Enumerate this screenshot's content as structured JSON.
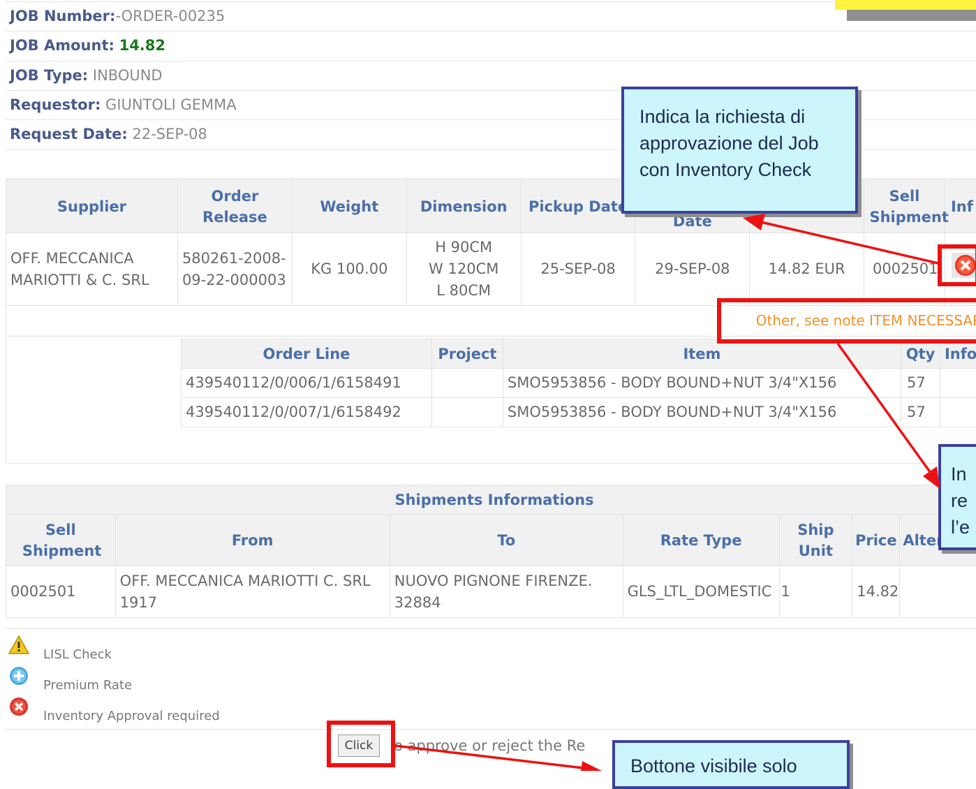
{
  "job": {
    "number_label": "JOB Number:",
    "number_value": "-ORDER-00235",
    "amount_label": "JOB Amount:",
    "amount_value": "14.82",
    "type_label": "JOB Type:",
    "type_value": "INBOUND",
    "requestor_label": "Requestor:",
    "requestor_value": "GIUNTOLI GEMMA",
    "date_label": "Request Date:",
    "date_value": "22-SEP-08"
  },
  "release_table": {
    "headers": [
      "Supplier",
      "Order Release",
      "Weight",
      "Dimension",
      "Pickup Date",
      "Date",
      "",
      "Sell Shipment",
      "Inf"
    ],
    "row": {
      "supplier": "OFF. MECCANICA MARIOTTI & C. SRL",
      "order_release": "580261-2008-09-22-000003",
      "weight": "KG 100.00",
      "dim_h": "H 90CM",
      "dim_w": "W 120CM",
      "dim_l": "L 80CM",
      "pickup_date": "25-SEP-08",
      "delivery_date": "29-SEP-08",
      "cost": "14.82 EUR",
      "sell_shipment": "0002501"
    },
    "note": "Other, see note ITEM NECESSAR"
  },
  "lines_table": {
    "headers": [
      "Order Line",
      "Project",
      "Item",
      "Qty",
      "Info"
    ],
    "rows": [
      {
        "order_line": "439540112/0/006/1/6158491",
        "project": "",
        "item": "SMO5953856 - BODY BOUND+NUT 3/4\"X156",
        "qty": "57",
        "info": ""
      },
      {
        "order_line": "439540112/0/007/1/6158492",
        "project": "",
        "item": "SMO5953856 - BODY BOUND+NUT 3/4\"X156",
        "qty": "57",
        "info": ""
      }
    ]
  },
  "shipments": {
    "title": "Shipments Informations",
    "headers": [
      "Sell Shipment",
      "From",
      "To",
      "Rate Type",
      "Ship Unit",
      "Price",
      "Alter"
    ],
    "row": {
      "sell_shipment": "0002501",
      "from": "OFF. MECCANICA MARIOTTI C. SRL 1917",
      "to": "NUOVO PIGNONE FIRENZE. 32884",
      "rate_type": "GLS_LTL_DOMESTIC",
      "ship_unit": "1",
      "price": "14.82",
      "alter": ""
    }
  },
  "legend": [
    {
      "icon": "warning-icon",
      "label": "LISL Check"
    },
    {
      "icon": "plus-circle-icon",
      "label": "Premium Rate"
    },
    {
      "icon": "x-circle-icon",
      "label": "Inventory Approval required"
    }
  ],
  "action": {
    "button_label": "Click",
    "text": "o approve or reject the Re"
  },
  "callouts": {
    "approval": "Indica la richiesta di approvazione del Job con Inventory Check",
    "reason_partial": "In re l’e",
    "button_partial": "Bottone visibile solo"
  },
  "colors": {
    "header_label": "#4a5a8a",
    "amount": "#1a7a1a",
    "table_header": "#4a6fa8",
    "note": "#f0922a",
    "callout_bg": "#ccf6fb",
    "callout_border": "#3b3fa0",
    "highlight": "#ee1111",
    "badge": "#fff23a"
  }
}
